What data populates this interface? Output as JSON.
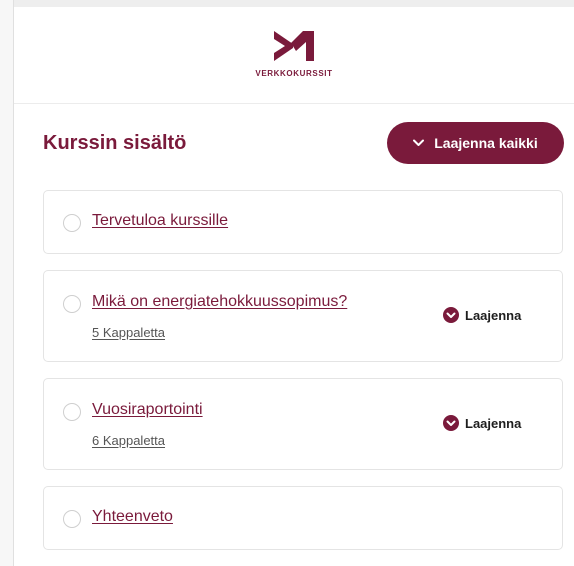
{
  "brand": {
    "name": "VERKKOKURSSIT",
    "color": "#7a1a3b"
  },
  "content": {
    "title": "Kurssin sisältö",
    "expand_all_label": "Laajenna kaikki"
  },
  "items": [
    {
      "title": "Tervetuloa kurssille",
      "subtitle": "",
      "expand_label": ""
    },
    {
      "title": "Mikä on energiatehokkuussopimus?",
      "subtitle": "5 Kappaletta",
      "expand_label": "Laajenna"
    },
    {
      "title": "Vuosiraportointi",
      "subtitle": "6 Kappaletta",
      "expand_label": "Laajenna"
    },
    {
      "title": "Yhteenveto",
      "subtitle": "",
      "expand_label": ""
    }
  ]
}
